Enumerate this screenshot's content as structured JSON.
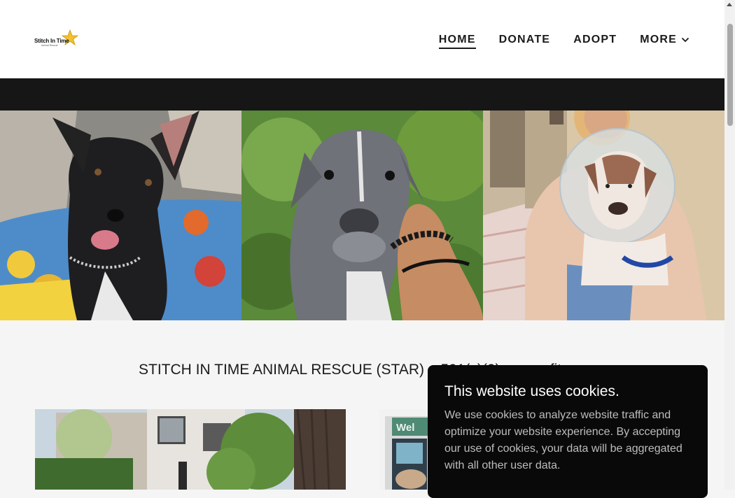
{
  "logo": {
    "text": "Stitch In Time",
    "subtext": "Animal Rescue"
  },
  "nav": {
    "items": [
      {
        "label": "HOME",
        "active": true
      },
      {
        "label": "DONATE",
        "active": false
      },
      {
        "label": "ADOPT",
        "active": false
      },
      {
        "label": "MORE",
        "active": false,
        "has_dropdown": true
      }
    ]
  },
  "main": {
    "headline": "STITCH IN TIME ANIMAL RESCUE (STAR) – 501(c)(3) nonprofit"
  },
  "cookie_banner": {
    "title": "This website uses cookies.",
    "body": "We use cookies to analyze website traffic and optimize your website experience. By accepting our use of cookies, your data will be aggregated with all other user data."
  },
  "colors": {
    "accent_star": "#f2c12e",
    "dark_bar": "#161616",
    "text": "#1b1b1b",
    "cookie_bg": "#090909"
  }
}
